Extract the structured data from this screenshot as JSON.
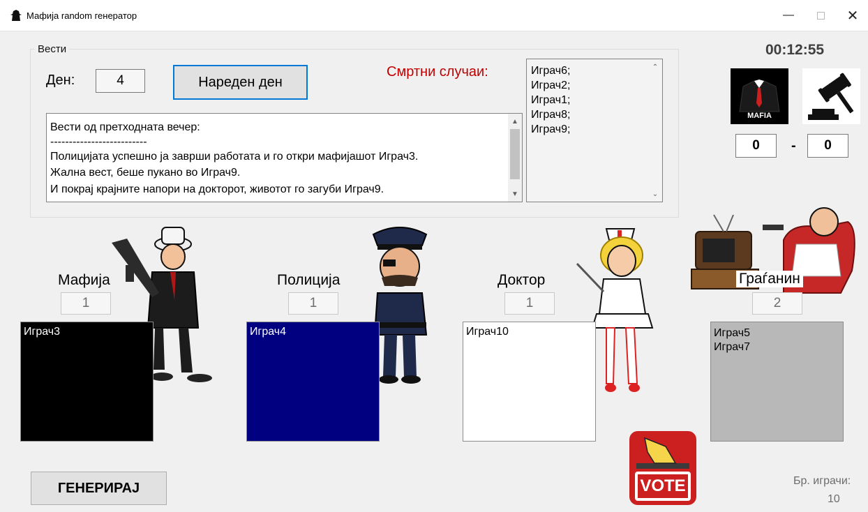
{
  "window": {
    "title": "Мафија random генератор"
  },
  "news": {
    "legend": "Вести",
    "day_label": "Ден:",
    "day_value": "4",
    "next_day_label": "Нареден ден",
    "deaths_label": "Смртни случаи:",
    "deaths": [
      "Играч6;",
      "Играч2;",
      "Играч1;",
      "Играч8;",
      "Играч9;"
    ],
    "lines": [
      "Вести од претходната вечер:",
      "--------------------------",
      "Полицијата успешно ја заврши работата и го откри мафијашот Играч3.",
      "Жална вест, беше пукано во Играч9.",
      "И покрај крајните напори на докторот, животот го загуби Играч9."
    ]
  },
  "timer": "00:12:55",
  "score": {
    "mafia_logo_text": "MAFIA",
    "mafia": "0",
    "separator": "-",
    "town": "0"
  },
  "roles": [
    {
      "label": "Мафија",
      "count": "1",
      "players": [
        "Играч3"
      ],
      "bg": "#000000",
      "fg": "#ffffff"
    },
    {
      "label": "Полиција",
      "count": "1",
      "players": [
        "Играч4"
      ],
      "bg": "#000080",
      "fg": "#ffffff"
    },
    {
      "label": "Доктор",
      "count": "1",
      "players": [
        "Играч10"
      ],
      "bg": "#ffffff",
      "fg": "#000000"
    },
    {
      "label": "Граѓанин",
      "count": "2",
      "players": [
        "Играч5",
        "Играч7"
      ],
      "bg": "#b8b8b8",
      "fg": "#000000"
    }
  ],
  "generate_label": "ГЕНЕРИРАЈ",
  "vote_label": "VOTE",
  "players_label": "Бр. играчи:",
  "players_value": "10",
  "colors": {
    "deaths_label": "#c00000",
    "focus_border": "#0078d7",
    "vote_red": "#cc1f1f"
  }
}
